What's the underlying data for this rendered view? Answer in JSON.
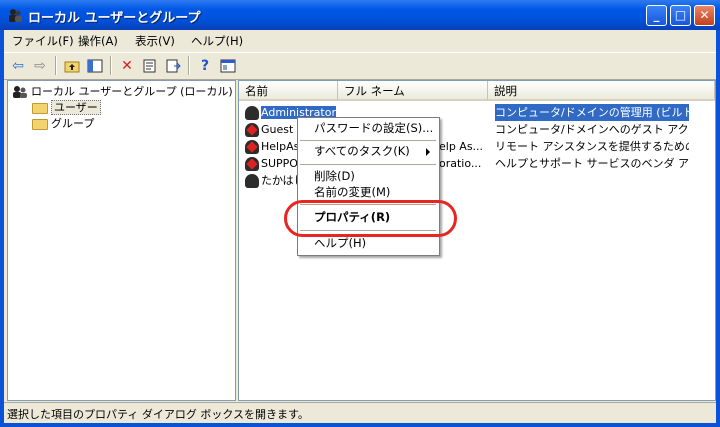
{
  "window": {
    "title": "ローカル ユーザーとグループ"
  },
  "caption_buttons": {
    "minimize": "_",
    "maximize": "□",
    "close": "✕"
  },
  "menu": [
    {
      "label": "ファイル(F)"
    },
    {
      "label": "操作(A)"
    },
    {
      "label": "表示(V)"
    },
    {
      "label": "ヘルプ(H)"
    }
  ],
  "toolbar": {
    "icons": [
      "back-arrow-icon",
      "forward-arrow-icon",
      "up-folder-icon",
      "show-hide-tree-icon",
      "delete-icon",
      "properties-icon",
      "export-list-icon",
      "help-icon",
      "mmc-console-icon"
    ],
    "glyphs": {
      "back": "⇦",
      "forward": "⇨",
      "delete": "✕",
      "help": "?"
    }
  },
  "tree": {
    "root": "ローカル ユーザーとグループ (ローカル)",
    "children": [
      "ユーザー",
      "グループ"
    ],
    "selected": "ユーザー"
  },
  "list": {
    "columns": [
      "名前",
      "フル ネーム",
      "説明"
    ],
    "rows": [
      {
        "name": "Administrator",
        "fullname": "",
        "desc": "コンピュータ/ドメインの管理用 (ビルトイ...",
        "selected": true,
        "icon": "user-icon"
      },
      {
        "name": "Guest",
        "fullname": "",
        "desc": "コンピュータ/ドメインへのゲスト アクセス...",
        "selected": false,
        "icon": "disabled-user-icon"
      },
      {
        "name": "HelpAs",
        "fullname": "elp As...",
        "desc": "リモート アシスタンスを提供するためのア...",
        "selected": false,
        "icon": "disabled-user-icon"
      },
      {
        "name": "SUPPO",
        "fullname": "oratio...",
        "desc": "ヘルプとサポート サービスのベンダ アカ...",
        "selected": false,
        "icon": "disabled-user-icon"
      },
      {
        "name": "たかはし",
        "fullname": "",
        "desc": "",
        "selected": false,
        "icon": "user-icon"
      }
    ]
  },
  "context_menu": {
    "items": [
      {
        "label": "パスワードの設定(S)..."
      },
      {
        "label": "すべてのタスク(K)"
      },
      {
        "label": "削除(D)"
      },
      {
        "label": "名前の変更(M)"
      },
      {
        "label": "プロパティ(R)"
      },
      {
        "label": "ヘルプ(H)"
      }
    ]
  },
  "annotation": {
    "ring_color": "#e8251f"
  },
  "status": {
    "text": "選択した項目のプロパティ ダイアログ ボックスを開きます。"
  },
  "colors": {
    "title_blue": "#0058e6",
    "selection": "#316ac5",
    "chrome": "#ece9d8"
  }
}
